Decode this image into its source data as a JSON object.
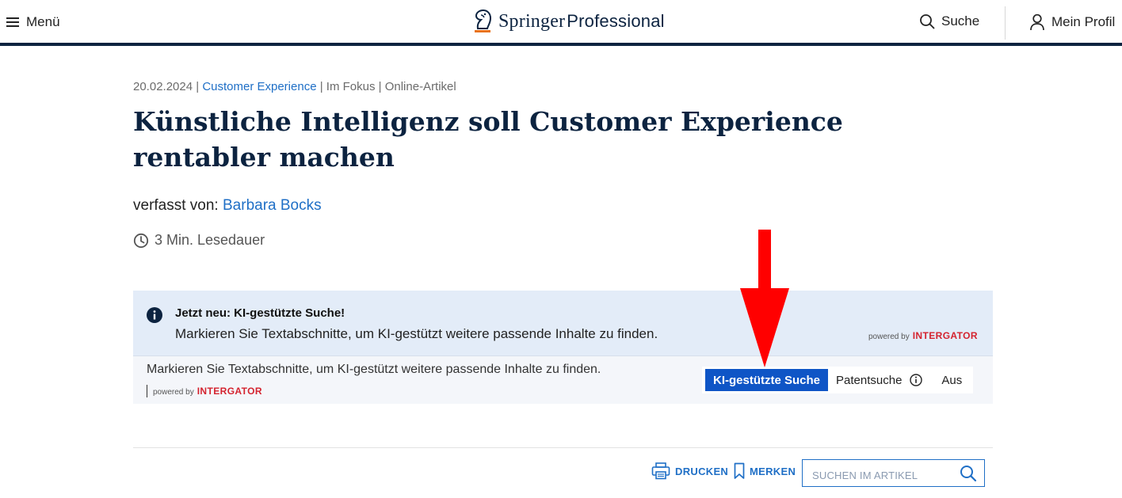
{
  "header": {
    "menu_label": "Menü",
    "logo_main": "Springer",
    "logo_sub": "Professional",
    "search_label": "Suche",
    "profile_label": "Mein Profil"
  },
  "article": {
    "date": "20.02.2024",
    "sep1": " | ",
    "category": "Customer Experience",
    "sep2": " | ",
    "section": "Im Fokus",
    "sep3": " | ",
    "type": "Online-Artikel",
    "title": "Künstliche Intelligenz soll Customer Experience rentabler machen",
    "byline_prefix": "verfasst von: ",
    "author": "Barbara Bocks",
    "read_time": "3 Min. Lesedauer"
  },
  "ki_notice": {
    "heading": "Jetzt neu: KI-gestützte Suche!",
    "description": "Markieren Sie Textabschnitte, um KI-gestützt weitere passende Inhalte zu finden.",
    "powered_by": "powered by",
    "brand": "INTERGATOR",
    "bottom_description": "Markieren Sie Textabschnitte, um KI-gestützt weitere passende Inhalte zu finden.",
    "options": {
      "ki_search": "KI-gestützte Suche",
      "patent_search": "Patentsuche",
      "off": "Aus"
    },
    "selected": "KI-gestützte Suche"
  },
  "tools": {
    "print_label": "DRUCKEN",
    "bookmark_label": "MERKEN",
    "search_placeholder": "SUCHEN IM ARTIKEL"
  },
  "colors": {
    "navy": "#0c2340",
    "link_blue": "#1f6fc6",
    "active_blue": "#0f55c6",
    "brand_red": "#d4232f",
    "annotation_arrow": "#ff0000"
  }
}
